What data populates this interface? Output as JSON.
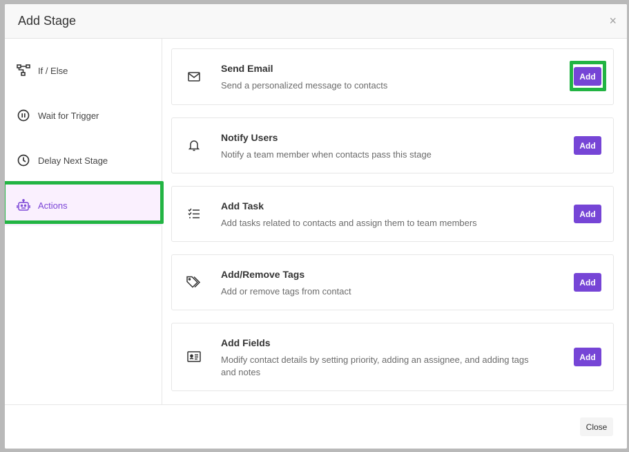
{
  "modal": {
    "title": "Add Stage",
    "close_icon_glyph": "×"
  },
  "sidebar": {
    "items": [
      {
        "label": "If / Else",
        "icon": "branch-icon"
      },
      {
        "label": "Wait for Trigger",
        "icon": "pause-circle-icon"
      },
      {
        "label": "Delay Next Stage",
        "icon": "clock-icon"
      },
      {
        "label": "Actions",
        "icon": "robot-icon",
        "active": true
      }
    ]
  },
  "actions": [
    {
      "title": "Send Email",
      "description": "Send a personalized message to contacts",
      "icon": "envelope-icon",
      "button": "Add"
    },
    {
      "title": "Notify Users",
      "description": "Notify a team member when contacts pass this stage",
      "icon": "bell-icon",
      "button": "Add"
    },
    {
      "title": "Add Task",
      "description": "Add tasks related to contacts and assign them to team members",
      "icon": "checklist-icon",
      "button": "Add"
    },
    {
      "title": "Add/Remove Tags",
      "description": "Add or remove tags from contact",
      "icon": "tags-icon",
      "button": "Add"
    },
    {
      "title": "Add Fields",
      "description": "Modify contact details by setting priority, adding an assignee, and adding tags and notes",
      "icon": "contact-card-icon",
      "button": "Add"
    }
  ],
  "footer": {
    "close_label": "Close"
  },
  "colors": {
    "accent": "#7645d6",
    "active_bg": "#faf0fe",
    "highlight": "#22b443"
  }
}
